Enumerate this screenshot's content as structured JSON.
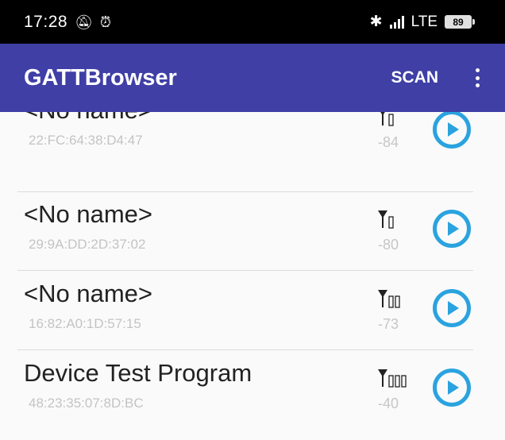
{
  "status_bar": {
    "time": "17:28",
    "left_icons": [
      "do-not-disturb-icon",
      "alarm-icon"
    ],
    "right_icons": [
      "bluetooth-icon",
      "signal-icon"
    ],
    "network": "LTE",
    "battery": "89"
  },
  "app_bar": {
    "title": "GATTBrowser",
    "scan_label": "SCAN",
    "overflow_icon": "more-vert-icon",
    "color": "#3f3fa6"
  },
  "devices": [
    {
      "name": "<No name>",
      "address": "22:FC:64:38:D4:47",
      "rssi": "-84",
      "signal_level": 1
    },
    {
      "name": "<No name>",
      "address": "29:9A:DD:2D:37:02",
      "rssi": "-80",
      "signal_level": 1
    },
    {
      "name": "<No name>",
      "address": "16:82:A0:1D:57:15",
      "rssi": "-73",
      "signal_level": 2
    },
    {
      "name": "Device Test Program",
      "address": "48:23:35:07:8D:BC",
      "rssi": "-40",
      "signal_level": 3
    }
  ],
  "accent_color": "#2aa3df"
}
